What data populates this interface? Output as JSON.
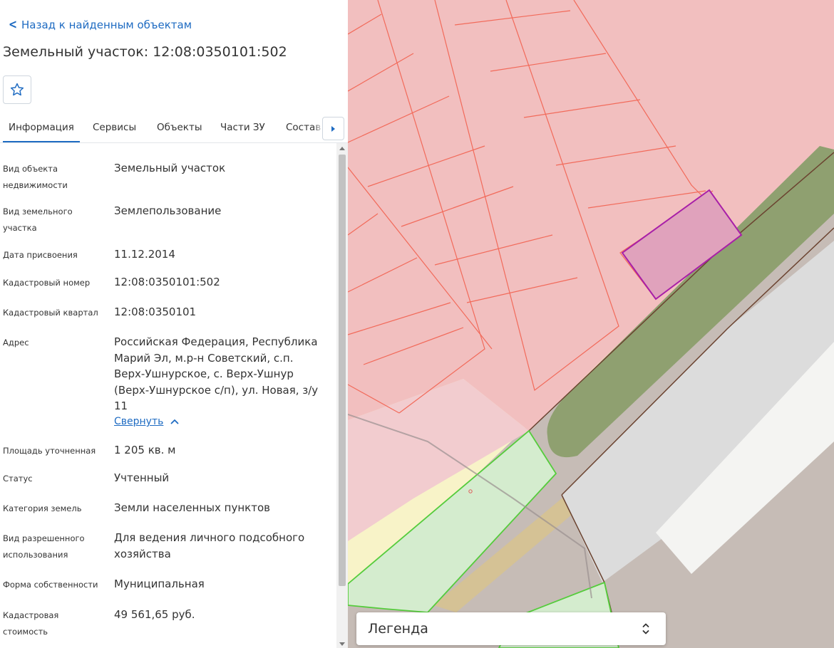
{
  "header": {
    "back_label": "Назад к найденным объектам",
    "title": "Земельный участок: 12:08:0350101:502",
    "favorite_icon": "star-outline-icon"
  },
  "tabs": [
    {
      "label": "Информация",
      "active": true
    },
    {
      "label": "Сервисы",
      "active": false
    },
    {
      "label": "Объекты",
      "active": false
    },
    {
      "label": "Части ЗУ",
      "active": false
    },
    {
      "label": "Состав",
      "active": false
    }
  ],
  "fields": [
    {
      "label": "Вид объекта недвижимости",
      "value": "Земельный участок"
    },
    {
      "label": "Вид земельного участка",
      "value": "Землепользование"
    },
    {
      "label": "Дата присвоения",
      "value": "11.12.2014"
    },
    {
      "label": "Кадастровый номер",
      "value": "12:08:0350101:502"
    },
    {
      "label": "Кадастровый квартал",
      "value": "12:08:0350101"
    },
    {
      "label": "Адрес",
      "value": "Российская Федерация, Республика Марий Эл, м.р-н Советский, с.п. Верх-Ушнурское, с. Верх-Ушнур (Верх-Ушнурское с/п), ул. Новая, з/у 11"
    },
    {
      "label": "Площадь уточненная",
      "value": "1 205 кв. м"
    },
    {
      "label": "Статус",
      "value": "Учтенный"
    },
    {
      "label": "Категория земель",
      "value": "Земли населенных пунктов"
    },
    {
      "label": "Вид разрешенного использования",
      "value": "Для ведения личного подсобного хозяйства"
    },
    {
      "label": "Форма собственности",
      "value": "Муниципальная"
    },
    {
      "label": "Кадастровая стоимость",
      "value": "49 561,65 руб."
    }
  ],
  "address_toggle_label": "Свернуть",
  "legend": {
    "label": "Легенда"
  },
  "colors": {
    "accent": "#1e6bc2",
    "parcel_fill": "#f2bfbf",
    "parcel_stroke": "#f26a5a",
    "selected_fill": "#e0a2bc",
    "selected_stroke": "#a81fa8",
    "green_fill": "#d4ecce",
    "green_stroke": "#55cc3c",
    "vegetation": "#8fa070",
    "road": "#c6bcb6",
    "yellow_area": "#f8f3c8"
  }
}
